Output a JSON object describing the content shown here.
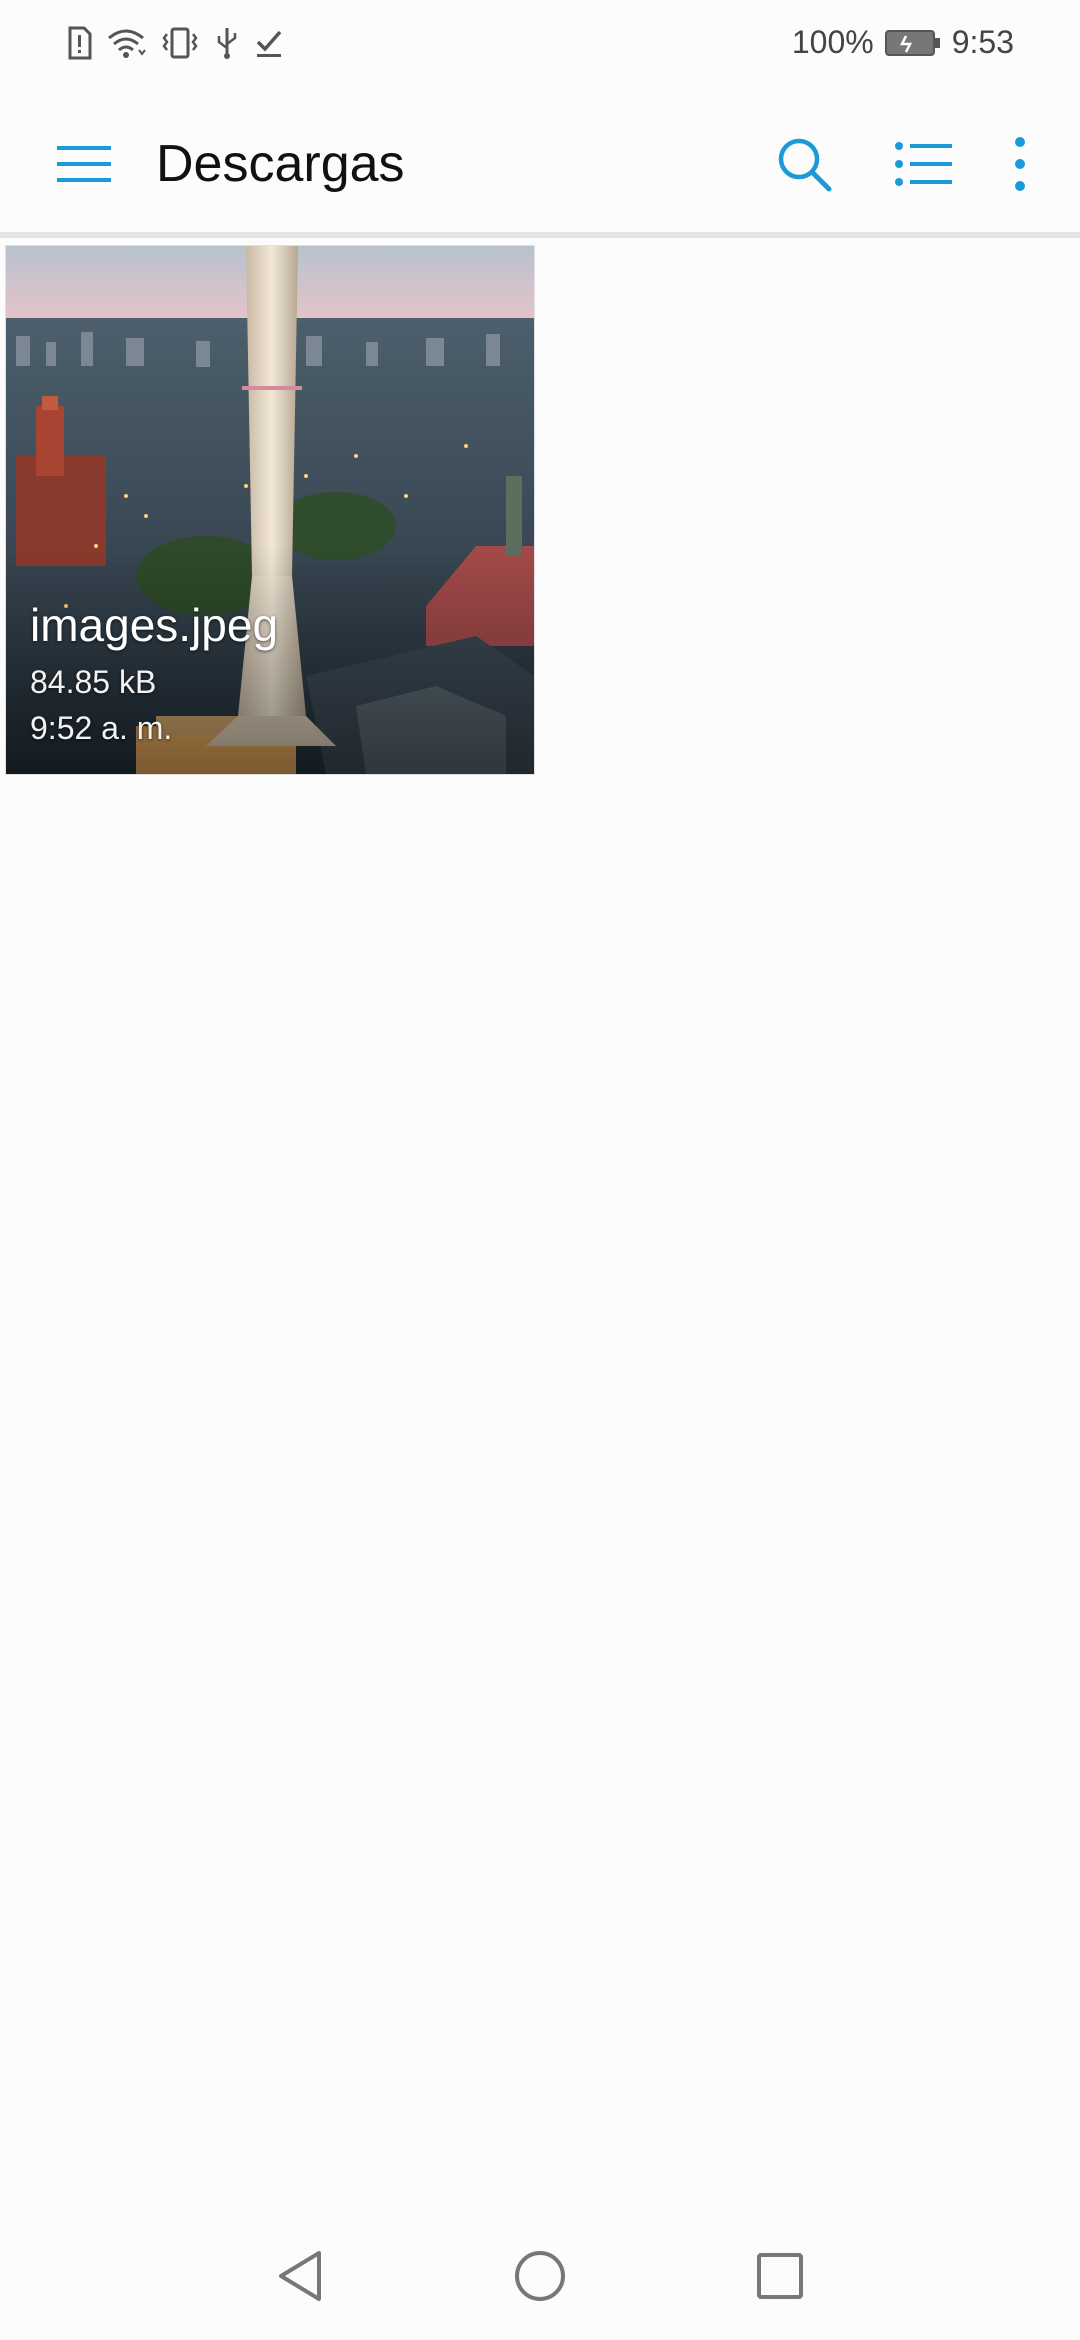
{
  "status_bar": {
    "icons": [
      "sim-alert-icon",
      "wifi-icon",
      "vibrate-icon",
      "usb-icon",
      "download-done-icon"
    ],
    "battery_percent": "100%",
    "battery_icon": "battery-charging-icon",
    "time": "9:53"
  },
  "toolbar": {
    "title": "Descargas",
    "menu_icon": "hamburger-menu-icon",
    "actions": [
      "search-icon",
      "list-view-icon",
      "more-vert-icon"
    ],
    "accent_color": "#1a9ad6"
  },
  "files": [
    {
      "name": "images.jpeg",
      "size": "84.85 kB",
      "time": "9:52 a. m."
    }
  ],
  "nav_bar": {
    "buttons": [
      "back-icon",
      "home-icon",
      "recents-icon"
    ]
  }
}
